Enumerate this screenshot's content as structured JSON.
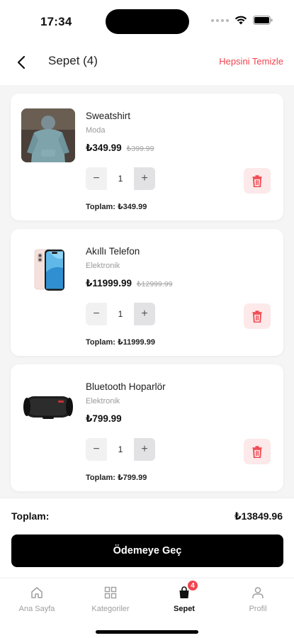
{
  "status_bar": {
    "time": "17:34"
  },
  "header": {
    "title": "Sepet (4)",
    "clear_all": "Hepsini Temizle"
  },
  "cart_items": [
    {
      "name": "Sweatshirt",
      "category": "Moda",
      "price": "₺349.99",
      "old_price": "₺399.99",
      "quantity": "1",
      "subtotal": "Toplam: ₺349.99",
      "image": "sweatshirt-photo"
    },
    {
      "name": "Akıllı Telefon",
      "category": "Elektronik",
      "price": "₺11999.99",
      "old_price": "₺12999.99",
      "quantity": "1",
      "subtotal": "Toplam: ₺11999.99",
      "image": "phone-photo"
    },
    {
      "name": "Bluetooth Hoparlör",
      "category": "Elektronik",
      "price": "₺799.99",
      "old_price": "",
      "quantity": "1",
      "subtotal": "Toplam: ₺799.99",
      "image": "speaker-photo"
    }
  ],
  "summary": {
    "total_label": "Toplam:",
    "total_value": "₺13849.96",
    "checkout_label": "Ödemeye Geç"
  },
  "tab_bar": {
    "tabs": [
      {
        "label": "Ana Sayfa",
        "icon": "home-icon"
      },
      {
        "label": "Kategoriler",
        "icon": "grid-icon"
      },
      {
        "label": "Sepet",
        "icon": "cart-bag-icon",
        "badge": "4",
        "active": true
      },
      {
        "label": "Profil",
        "icon": "person-icon"
      }
    ]
  },
  "colors": {
    "accent_red": "#f0454f",
    "delete_bg": "#fde9ea",
    "primary_button": "#000000"
  }
}
